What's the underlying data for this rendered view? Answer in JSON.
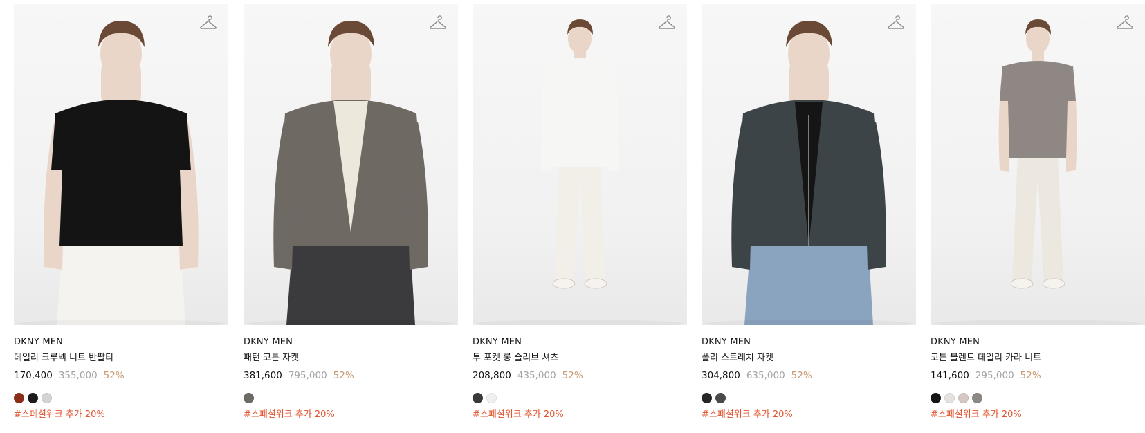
{
  "products": [
    {
      "brand": "DKNY MEN",
      "name": "데일리 크루넥 니트 반팔티",
      "sale_price": "170,400",
      "original_price": "355,000",
      "discount": "52%",
      "swatches": [
        "#8b2e18",
        "#1c1c1c",
        "#d4d4d4"
      ],
      "tag": "#스페셜위크 추가 20%",
      "garment": {
        "top": "#141414",
        "bottom": "#f4f3ef",
        "type": "tshirt"
      }
    },
    {
      "brand": "DKNY MEN",
      "name": "패턴 코튼 자켓",
      "sale_price": "381,600",
      "original_price": "795,000",
      "discount": "52%",
      "swatches": [
        "#6e6a66"
      ],
      "tag": "#스페셜위크 추가 20%",
      "garment": {
        "top": "#6f6964",
        "bottom": "#3b3b3d",
        "type": "blazer"
      }
    },
    {
      "brand": "DKNY MEN",
      "name": "투 포켓 롱 슬리브 셔츠",
      "sale_price": "208,800",
      "original_price": "435,000",
      "discount": "52%",
      "swatches": [
        "#3a3a3a",
        "#f0f0f0"
      ],
      "tag": "#스페셜위크 추가 20%",
      "garment": {
        "top": "#f6f6f4",
        "bottom": "#f1efe8",
        "type": "shirt"
      }
    },
    {
      "brand": "DKNY MEN",
      "name": "폴리 스트레치 자켓",
      "sale_price": "304,800",
      "original_price": "635,000",
      "discount": "52%",
      "swatches": [
        "#262626",
        "#4a4a4a"
      ],
      "tag": "#스페셜위크 추가 20%",
      "garment": {
        "top": "#3c4447",
        "bottom": "#8aa3bf",
        "type": "jacket"
      }
    },
    {
      "brand": "DKNY MEN",
      "name": "코튼 블렌드 데일리 카라 니트",
      "sale_price": "141,600",
      "original_price": "295,000",
      "discount": "52%",
      "swatches": [
        "#151515",
        "#e4e2df",
        "#d6c7c2",
        "#8c8884"
      ],
      "tag": "#스페셜위크 추가 20%",
      "garment": {
        "top": "#8f8783",
        "bottom": "#ece8df",
        "type": "polo"
      }
    }
  ]
}
